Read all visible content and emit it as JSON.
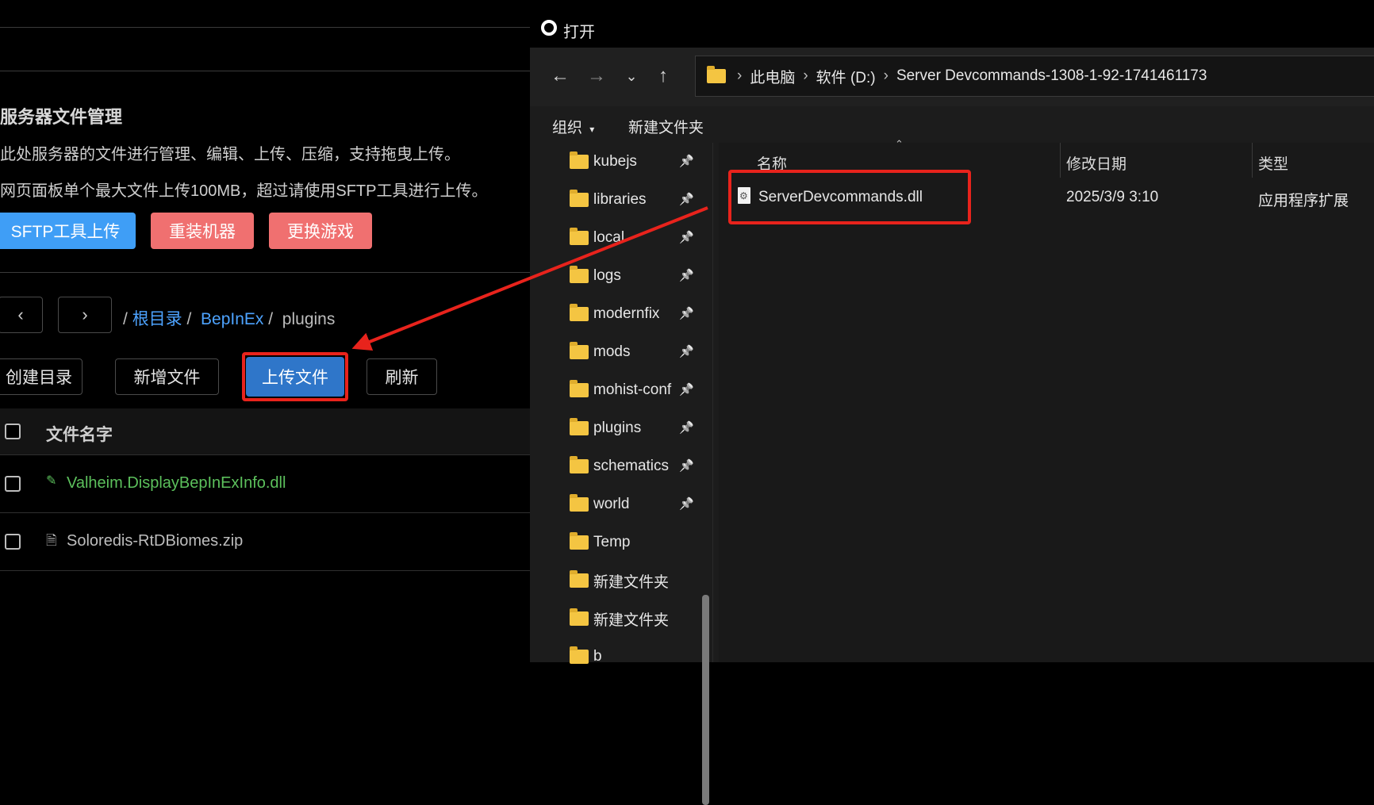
{
  "web": {
    "title": "服务器文件管理",
    "desc1": "此处服务器的文件进行管理、编辑、上传、压缩，支持拖曳上传。",
    "desc2": "网页面板单个最大文件上传100MB，超过请使用SFTP工具进行上传。",
    "buttons": {
      "sftp": "SFTP工具上传",
      "reinstall": "重装机器",
      "change_game": "更换游戏"
    },
    "nav": {
      "back": "‹",
      "forward": "›"
    },
    "breadcrumb": {
      "sep": "/",
      "root": "根目录",
      "bepinex": "BepInEx",
      "current": "plugins"
    },
    "actions": {
      "mkdir": "创建目录",
      "new_file": "新增文件",
      "upload": "上传文件",
      "refresh": "刷新"
    },
    "table": {
      "header": "文件名字",
      "rows": [
        {
          "name": "Valheim.DisplayBepInExInfo.dll",
          "color": "#5cc05c"
        },
        {
          "name": "Soloredis-RtDBiomes.zip",
          "color": "#bdbdbd"
        }
      ]
    }
  },
  "dialog": {
    "title": "打开",
    "address": {
      "pc": "此电脑",
      "drive": "软件 (D:)",
      "folder": "Server Devcommands-1308-1-92-1741461173"
    },
    "commands": {
      "organize": "组织",
      "new_folder": "新建文件夹"
    },
    "nav_folders": [
      {
        "name": "kubejs",
        "pinned": true
      },
      {
        "name": "libraries",
        "pinned": true
      },
      {
        "name": "local",
        "pinned": true
      },
      {
        "name": "logs",
        "pinned": true
      },
      {
        "name": "modernfix",
        "pinned": true
      },
      {
        "name": "mods",
        "pinned": true
      },
      {
        "name": "mohist-conf",
        "pinned": true
      },
      {
        "name": "plugins",
        "pinned": true
      },
      {
        "name": "schematics",
        "pinned": true
      },
      {
        "name": "world",
        "pinned": true
      },
      {
        "name": "Temp",
        "pinned": false
      },
      {
        "name": "新建文件夹",
        "pinned": false
      },
      {
        "name": "新建文件夹",
        "pinned": false
      },
      {
        "name": "b",
        "pinned": false
      }
    ],
    "columns": {
      "name": "名称",
      "date": "修改日期",
      "type": "类型"
    },
    "files": [
      {
        "name": "ServerDevcommands.dll",
        "date": "2025/3/9 3:10",
        "type": "应用程序扩展"
      }
    ]
  },
  "colors": {
    "accent_blue": "#3f9ef6",
    "danger_red": "#f07070",
    "highlight_red": "#e8231c",
    "folder_yellow": "#f4c542"
  }
}
